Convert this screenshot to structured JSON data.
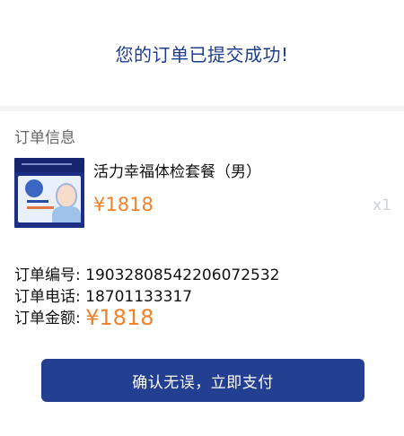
{
  "header": {
    "title": "您的订单已提交成功!"
  },
  "order_info": {
    "section_title": "订单信息",
    "product": {
      "name": "活力幸福体检套餐（男）",
      "price": "¥1818",
      "quantity": "x1",
      "thumbnail_icon": "checkup-package-image"
    },
    "order_number_label": "订单编号:",
    "order_number": "19032808542206072532",
    "order_phone_label": "订单电话:",
    "order_phone": "18701133317",
    "order_amount_label": "订单金额:",
    "order_amount": "¥1818"
  },
  "actions": {
    "confirm_label": "确认无误，立即支付"
  },
  "colors": {
    "accent": "#233f91",
    "price": "#f28229",
    "title": "#1f3d8c"
  }
}
